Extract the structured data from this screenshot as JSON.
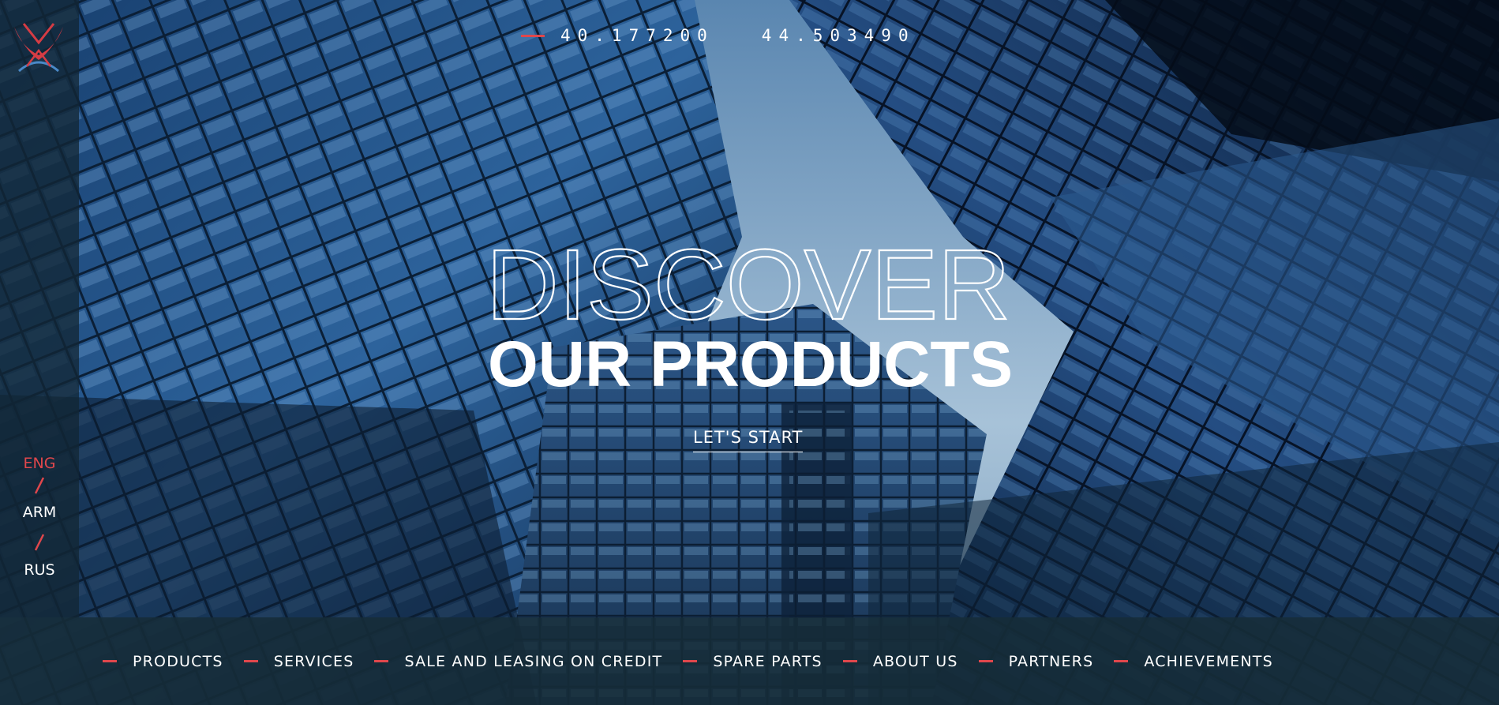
{
  "brand": {
    "logo_icon": "stylized-x-logo-icon",
    "accent_color": "#e0474c"
  },
  "coordinates": {
    "latitude": "40.177200",
    "longitude": "44.503490"
  },
  "hero": {
    "title_outline": "DISCOVER",
    "title_solid": "OUR PRODUCTS",
    "cta_label": "LET'S START"
  },
  "languages": [
    {
      "code": "ENG",
      "active": true
    },
    {
      "code": "ARM",
      "active": false
    },
    {
      "code": "RUS",
      "active": false
    }
  ],
  "nav": {
    "items": [
      {
        "label": "PRODUCTS"
      },
      {
        "label": "SERVICES"
      },
      {
        "label": "SALE AND LEASING ON CREDIT"
      },
      {
        "label": "SPARE PARTS"
      },
      {
        "label": "ABOUT US"
      },
      {
        "label": "PARTNERS"
      },
      {
        "label": "ACHIEVEMENTS"
      }
    ]
  }
}
